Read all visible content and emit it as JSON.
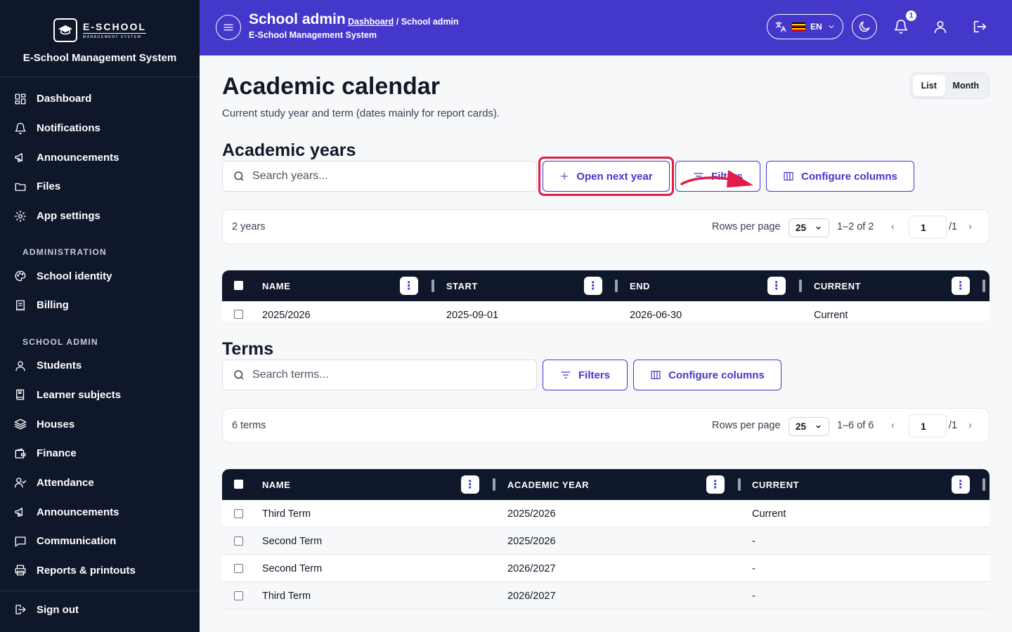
{
  "brand": {
    "logo_main": "E-SCHOOL",
    "logo_sub": "MANAGEMENT SYSTEM",
    "title": "E-School Management System"
  },
  "sidebar": {
    "items": [
      {
        "label": "Dashboard",
        "icon": "dashboard-icon"
      },
      {
        "label": "Notifications",
        "icon": "bell-icon"
      },
      {
        "label": "Announcements",
        "icon": "megaphone-icon"
      },
      {
        "label": "Files",
        "icon": "folder-icon"
      },
      {
        "label": "App settings",
        "icon": "gear-icon"
      }
    ],
    "section_admin": "ADMINISTRATION",
    "admin_items": [
      {
        "label": "School identity",
        "icon": "palette-icon"
      },
      {
        "label": "Billing",
        "icon": "receipt-icon"
      }
    ],
    "section_school": "SCHOOL ADMIN",
    "school_items": [
      {
        "label": "Students",
        "icon": "user-icon"
      },
      {
        "label": "Learner subjects",
        "icon": "book-icon"
      },
      {
        "label": "Houses",
        "icon": "layers-icon"
      },
      {
        "label": "Finance",
        "icon": "wallet-icon"
      },
      {
        "label": "Attendance",
        "icon": "user-check-icon"
      },
      {
        "label": "Announcements",
        "icon": "megaphone-icon"
      },
      {
        "label": "Communication",
        "icon": "message-icon"
      },
      {
        "label": "Reports & printouts",
        "icon": "printer-icon"
      }
    ],
    "signout": "Sign out"
  },
  "header": {
    "title": "School admin",
    "breadcrumb_link": "Dashboard",
    "breadcrumb_current": " / School admin",
    "subtitle": "E-School Management System",
    "language": "EN",
    "notification_count": "1"
  },
  "page": {
    "title": "Academic calendar",
    "description": "Current study year and term (dates mainly for report cards).",
    "view_list": "List",
    "view_month": "Month"
  },
  "years": {
    "title": "Academic years",
    "search_placeholder": "Search years...",
    "open_next": "Open next year",
    "filters": "Filters",
    "configure": "Configure columns",
    "count": "2 years",
    "rows_per_page": "Rows per page",
    "rows_value": "25",
    "range": "1–2 of 2",
    "page": "1",
    "page_total": "/1",
    "columns": [
      "NAME",
      "START",
      "END",
      "CURRENT"
    ],
    "rows": [
      {
        "name": "2025/2026",
        "start": "2025-09-01",
        "end": "2026-06-30",
        "current": "Current"
      }
    ]
  },
  "terms": {
    "title": "Terms",
    "search_placeholder": "Search terms...",
    "filters": "Filters",
    "configure": "Configure columns",
    "count": "6 terms",
    "rows_per_page": "Rows per page",
    "rows_value": "25",
    "range": "1–6 of 6",
    "page": "1",
    "page_total": "/1",
    "columns": [
      "NAME",
      "ACADEMIC YEAR",
      "CURRENT"
    ],
    "rows": [
      {
        "name": "Third Term",
        "year": "2025/2026",
        "current": "Current"
      },
      {
        "name": "Second Term",
        "year": "2025/2026",
        "current": "-"
      },
      {
        "name": "Second Term",
        "year": "2026/2027",
        "current": "-"
      },
      {
        "name": "Third Term",
        "year": "2026/2027",
        "current": "-"
      }
    ]
  },
  "colors": {
    "accent": "#4338ca",
    "sidebar": "#0f172a",
    "highlight": "#e11d48"
  }
}
